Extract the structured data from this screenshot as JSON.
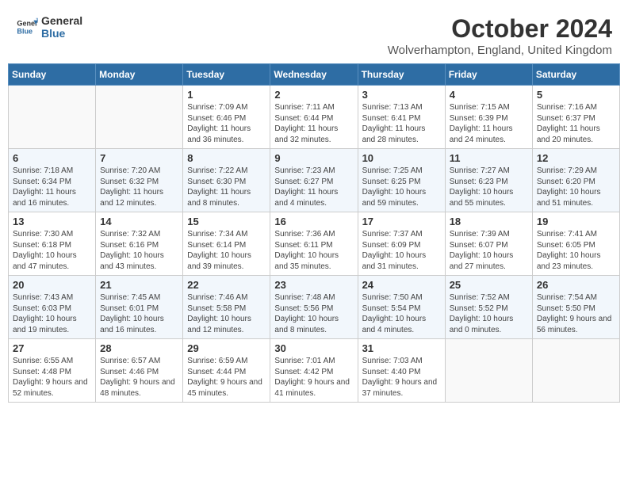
{
  "header": {
    "logo_line1": "General",
    "logo_line2": "Blue",
    "month": "October 2024",
    "location": "Wolverhampton, England, United Kingdom"
  },
  "days_of_week": [
    "Sunday",
    "Monday",
    "Tuesday",
    "Wednesday",
    "Thursday",
    "Friday",
    "Saturday"
  ],
  "weeks": [
    [
      {
        "day": "",
        "info": ""
      },
      {
        "day": "",
        "info": ""
      },
      {
        "day": "1",
        "info": "Sunrise: 7:09 AM\nSunset: 6:46 PM\nDaylight: 11 hours and 36 minutes."
      },
      {
        "day": "2",
        "info": "Sunrise: 7:11 AM\nSunset: 6:44 PM\nDaylight: 11 hours and 32 minutes."
      },
      {
        "day": "3",
        "info": "Sunrise: 7:13 AM\nSunset: 6:41 PM\nDaylight: 11 hours and 28 minutes."
      },
      {
        "day": "4",
        "info": "Sunrise: 7:15 AM\nSunset: 6:39 PM\nDaylight: 11 hours and 24 minutes."
      },
      {
        "day": "5",
        "info": "Sunrise: 7:16 AM\nSunset: 6:37 PM\nDaylight: 11 hours and 20 minutes."
      }
    ],
    [
      {
        "day": "6",
        "info": "Sunrise: 7:18 AM\nSunset: 6:34 PM\nDaylight: 11 hours and 16 minutes."
      },
      {
        "day": "7",
        "info": "Sunrise: 7:20 AM\nSunset: 6:32 PM\nDaylight: 11 hours and 12 minutes."
      },
      {
        "day": "8",
        "info": "Sunrise: 7:22 AM\nSunset: 6:30 PM\nDaylight: 11 hours and 8 minutes."
      },
      {
        "day": "9",
        "info": "Sunrise: 7:23 AM\nSunset: 6:27 PM\nDaylight: 11 hours and 4 minutes."
      },
      {
        "day": "10",
        "info": "Sunrise: 7:25 AM\nSunset: 6:25 PM\nDaylight: 10 hours and 59 minutes."
      },
      {
        "day": "11",
        "info": "Sunrise: 7:27 AM\nSunset: 6:23 PM\nDaylight: 10 hours and 55 minutes."
      },
      {
        "day": "12",
        "info": "Sunrise: 7:29 AM\nSunset: 6:20 PM\nDaylight: 10 hours and 51 minutes."
      }
    ],
    [
      {
        "day": "13",
        "info": "Sunrise: 7:30 AM\nSunset: 6:18 PM\nDaylight: 10 hours and 47 minutes."
      },
      {
        "day": "14",
        "info": "Sunrise: 7:32 AM\nSunset: 6:16 PM\nDaylight: 10 hours and 43 minutes."
      },
      {
        "day": "15",
        "info": "Sunrise: 7:34 AM\nSunset: 6:14 PM\nDaylight: 10 hours and 39 minutes."
      },
      {
        "day": "16",
        "info": "Sunrise: 7:36 AM\nSunset: 6:11 PM\nDaylight: 10 hours and 35 minutes."
      },
      {
        "day": "17",
        "info": "Sunrise: 7:37 AM\nSunset: 6:09 PM\nDaylight: 10 hours and 31 minutes."
      },
      {
        "day": "18",
        "info": "Sunrise: 7:39 AM\nSunset: 6:07 PM\nDaylight: 10 hours and 27 minutes."
      },
      {
        "day": "19",
        "info": "Sunrise: 7:41 AM\nSunset: 6:05 PM\nDaylight: 10 hours and 23 minutes."
      }
    ],
    [
      {
        "day": "20",
        "info": "Sunrise: 7:43 AM\nSunset: 6:03 PM\nDaylight: 10 hours and 19 minutes."
      },
      {
        "day": "21",
        "info": "Sunrise: 7:45 AM\nSunset: 6:01 PM\nDaylight: 10 hours and 16 minutes."
      },
      {
        "day": "22",
        "info": "Sunrise: 7:46 AM\nSunset: 5:58 PM\nDaylight: 10 hours and 12 minutes."
      },
      {
        "day": "23",
        "info": "Sunrise: 7:48 AM\nSunset: 5:56 PM\nDaylight: 10 hours and 8 minutes."
      },
      {
        "day": "24",
        "info": "Sunrise: 7:50 AM\nSunset: 5:54 PM\nDaylight: 10 hours and 4 minutes."
      },
      {
        "day": "25",
        "info": "Sunrise: 7:52 AM\nSunset: 5:52 PM\nDaylight: 10 hours and 0 minutes."
      },
      {
        "day": "26",
        "info": "Sunrise: 7:54 AM\nSunset: 5:50 PM\nDaylight: 9 hours and 56 minutes."
      }
    ],
    [
      {
        "day": "27",
        "info": "Sunrise: 6:55 AM\nSunset: 4:48 PM\nDaylight: 9 hours and 52 minutes."
      },
      {
        "day": "28",
        "info": "Sunrise: 6:57 AM\nSunset: 4:46 PM\nDaylight: 9 hours and 48 minutes."
      },
      {
        "day": "29",
        "info": "Sunrise: 6:59 AM\nSunset: 4:44 PM\nDaylight: 9 hours and 45 minutes."
      },
      {
        "day": "30",
        "info": "Sunrise: 7:01 AM\nSunset: 4:42 PM\nDaylight: 9 hours and 41 minutes."
      },
      {
        "day": "31",
        "info": "Sunrise: 7:03 AM\nSunset: 4:40 PM\nDaylight: 9 hours and 37 minutes."
      },
      {
        "day": "",
        "info": ""
      },
      {
        "day": "",
        "info": ""
      }
    ]
  ]
}
